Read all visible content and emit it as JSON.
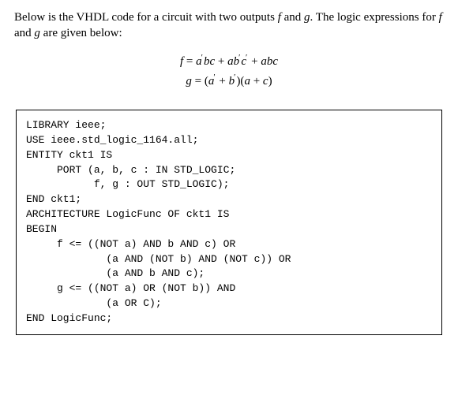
{
  "intro": {
    "part1": "Below is the VHDL code for a circuit with two outputs ",
    "f": "f",
    "part2": " and ",
    "g": "g",
    "part3": ". The logic expressions for ",
    "part4": " and ",
    "part5": " are given below:"
  },
  "equations": {
    "f_lhs": "f",
    "eq1": " = ",
    "f_rhs_html": "a′bc + ab′c′ + abc",
    "g_lhs": "g",
    "eq2": " = ",
    "g_rhs_html": "(a′ + b′)(a + c)"
  },
  "code": {
    "l1": "LIBRARY ieee;",
    "l2": "USE ieee.std_logic_1164.all;",
    "l3": "ENTITY ckt1 IS",
    "l4": "     PORT (a, b, c : IN STD_LOGIC;",
    "l5": "           f, g : OUT STD_LOGIC);",
    "l6": "END ckt1;",
    "l7": "ARCHITECTURE LogicFunc OF ckt1 IS",
    "l8": "BEGIN",
    "l9": "     f <= ((NOT a) AND b AND c) OR",
    "l10": "             (a AND (NOT b) AND (NOT c)) OR",
    "l11": "             (a AND b AND c);",
    "l12": "     g <= ((NOT a) OR (NOT b)) AND",
    "l13": "             (a OR C);",
    "l14": "END LogicFunc;"
  }
}
